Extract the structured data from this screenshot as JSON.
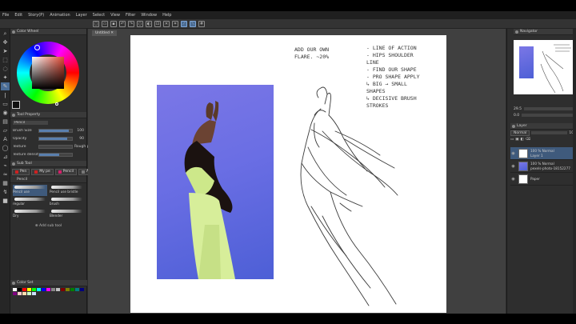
{
  "menu": [
    "File",
    "Edit",
    "Story(P)",
    "Animation",
    "Layer",
    "Select",
    "View",
    "Filter",
    "Window",
    "Help"
  ],
  "doc_tab": "Untitled",
  "left_panel": {
    "color_wheel_tab": "Color Wheel",
    "tool_property_tab": "Tool Property",
    "brush_name": "Pencil",
    "properties": [
      {
        "label": "Brush Size",
        "value": "100",
        "fill": 0.9
      },
      {
        "label": "Opacity",
        "value": "90",
        "fill": 0.85
      },
      {
        "label": "Texture",
        "value": "Rough paper",
        "fill": 0
      },
      {
        "label": "Texture density",
        "value": "",
        "fill": 0.6
      }
    ],
    "subtool_tab": "Sub Tool",
    "subtools": [
      "Pen",
      "My pe",
      "Pencil",
      "Air"
    ],
    "pencil_header": "Pencil",
    "brushes": [
      {
        "name": "Pencil use",
        "selected": true
      },
      {
        "name": "Pencil use bristle",
        "selected": false
      },
      {
        "name": "regular",
        "selected": false
      },
      {
        "name": "brush",
        "selected": false
      },
      {
        "name": "Dry",
        "selected": false
      },
      {
        "name": "Blender",
        "selected": false
      }
    ],
    "add_tool": "Add sub tool",
    "palette_tab": "Color Set",
    "palette_colors": [
      "#ffffff",
      "#000000",
      "#ff0000",
      "#ffff00",
      "#00ff00",
      "#00ffff",
      "#0000ff",
      "#ff00ff",
      "#888888",
      "#c0c0c0",
      "#800000",
      "#808000",
      "#008000",
      "#008080",
      "#000080",
      "#800080",
      "#ffcccc",
      "#ffe0b0",
      "#ccffcc",
      "#cce0ff"
    ]
  },
  "canvas": {
    "notes_left": [
      "ADD OUR OWN",
      "FLARE. ~20%"
    ],
    "notes_right": [
      "- LINE OF ACTION",
      "- HIPS  SHOULDER",
      "   LINE",
      "- FIND OUR SHAPE",
      "- PRO SHAPE APPLY",
      "  ↳ BIG → SMALL",
      "     SHAPES",
      "  ↳ DECISIVE BRUSH",
      "     STROKES"
    ]
  },
  "right_dock": {
    "navigator_tab": "Navigator",
    "zoom_value": "29.5",
    "rotate_value": "0.0",
    "layer_tab": "Layer",
    "blend_mode": "Normal",
    "opacity": "100",
    "layers": [
      {
        "line1": "100 % Normal",
        "line2": "Layer 1",
        "selected": true,
        "thumb": "white"
      },
      {
        "line1": "100 % Normal",
        "line2": "pexels-photo-18152277",
        "selected": false,
        "thumb": "photo"
      },
      {
        "line1": "",
        "line2": "Paper",
        "selected": false,
        "thumb": "white"
      }
    ]
  },
  "colors": {
    "accent": "#4a6d96",
    "panel": "#2e2e2e",
    "canvas_bg": "#404040"
  }
}
